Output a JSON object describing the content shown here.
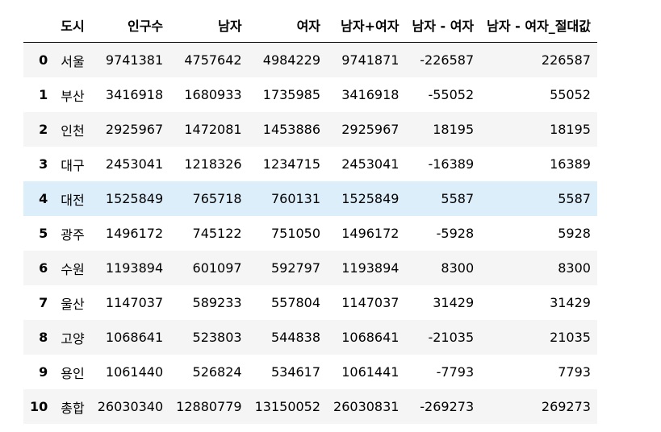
{
  "table": {
    "columns": [
      "",
      "도시",
      "인구수",
      "남자",
      "여자",
      "남자+여자",
      "남자 - 여자",
      "남자 - 여자_절대값"
    ],
    "rows": [
      [
        "0",
        "서울",
        "9741381",
        "4757642",
        "4984229",
        "9741871",
        "-226587",
        "226587"
      ],
      [
        "1",
        "부산",
        "3416918",
        "1680933",
        "1735985",
        "3416918",
        "-55052",
        "55052"
      ],
      [
        "2",
        "인천",
        "2925967",
        "1472081",
        "1453886",
        "2925967",
        "18195",
        "18195"
      ],
      [
        "3",
        "대구",
        "2453041",
        "1218326",
        "1234715",
        "2453041",
        "-16389",
        "16389"
      ],
      [
        "4",
        "대전",
        "1525849",
        "765718",
        "760131",
        "1525849",
        "5587",
        "5587"
      ],
      [
        "5",
        "광주",
        "1496172",
        "745122",
        "751050",
        "1496172",
        "-5928",
        "5928"
      ],
      [
        "6",
        "수원",
        "1193894",
        "601097",
        "592797",
        "1193894",
        "8300",
        "8300"
      ],
      [
        "7",
        "울산",
        "1147037",
        "589233",
        "557804",
        "1147037",
        "31429",
        "31429"
      ],
      [
        "8",
        "고양",
        "1068641",
        "523803",
        "544838",
        "1068641",
        "-21035",
        "21035"
      ],
      [
        "9",
        "용인",
        "1061440",
        "526824",
        "534617",
        "1061441",
        "-7793",
        "7793"
      ],
      [
        "10",
        "총합",
        "26030340",
        "12880779",
        "13150052",
        "26030831",
        "-269273",
        "269273"
      ]
    ],
    "hovered_row_index": 4,
    "colors": {
      "stripe": "#f5f5f5",
      "hover": "#ddeefb",
      "header_rule": "#000000"
    }
  }
}
